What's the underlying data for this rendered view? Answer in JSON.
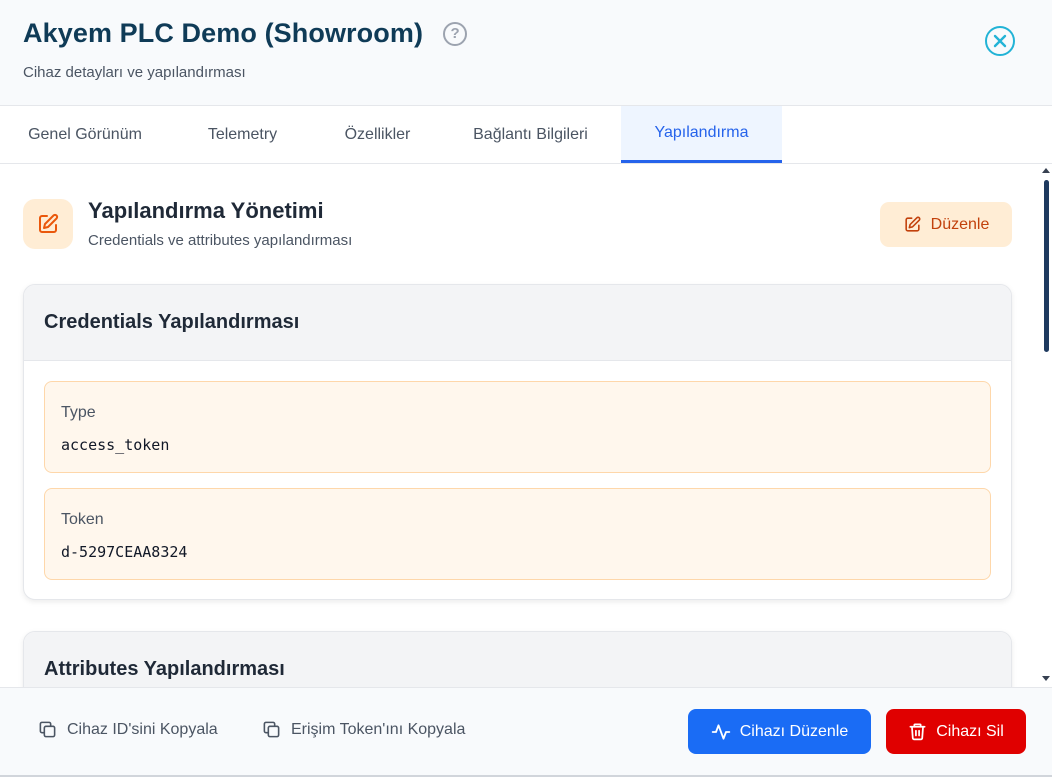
{
  "header": {
    "title": "Akyem PLC Demo (Showroom)",
    "subtitle": "Cihaz detayları ve yapılandırması"
  },
  "tabs": [
    {
      "label": "Genel Görünüm",
      "active": false
    },
    {
      "label": "Telemetry",
      "active": false
    },
    {
      "label": "Özellikler",
      "active": false
    },
    {
      "label": "Bağlantı Bilgileri",
      "active": false
    },
    {
      "label": "Yapılandırma",
      "active": true
    }
  ],
  "section": {
    "title": "Yapılandırma Yönetimi",
    "subtitle": "Credentials ve attributes yapılandırması",
    "edit_label": "Düzenle"
  },
  "credentials": {
    "title": "Credentials Yapılandırması",
    "fields": [
      {
        "label": "Type",
        "value": "access_token"
      },
      {
        "label": "Token",
        "value": "d-5297CEAA8324"
      }
    ]
  },
  "attributes": {
    "title": "Attributes Yapılandırması"
  },
  "footer": {
    "copy_id_label": "Cihaz ID'sini Kopyala",
    "copy_token_label": "Erişim Token'ını Kopyala",
    "edit_device_label": "Cihazı Düzenle",
    "delete_device_label": "Cihazı Sil"
  },
  "colors": {
    "accent": "#2563eb",
    "title": "#0f3b57",
    "close": "#22b3d6",
    "orange_bg": "#ffedd5",
    "orange_text": "#c2410c",
    "danger": "#e00000",
    "primary": "#1a6cf5"
  },
  "icons": {
    "help": "question-circle-icon",
    "close": "close-circle-icon",
    "section": "pencil-square-icon",
    "copy": "copy-icon",
    "activity": "activity-icon",
    "trash": "trash-icon"
  }
}
